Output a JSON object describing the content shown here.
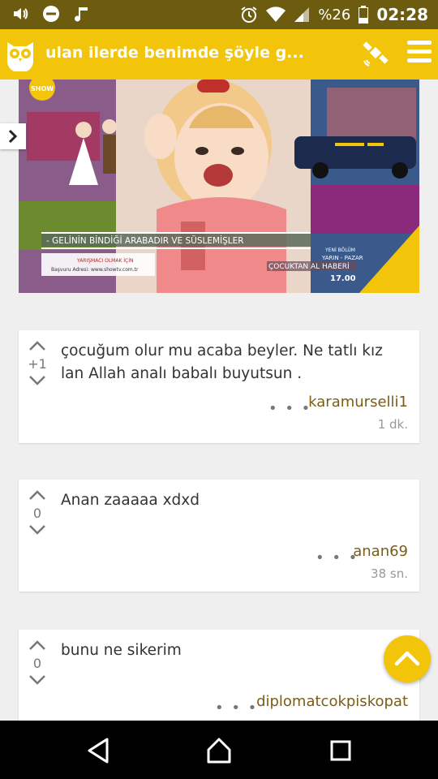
{
  "status_bar": {
    "battery": "%26",
    "time": "02:28"
  },
  "app_bar": {
    "title": "ulan ilerde benimde şöyle g..."
  },
  "media": {
    "badge_show": "SHOW",
    "banner": "- GELİNİN BİNDİĞİ ARABADIR VE SÜSLEMİŞLER",
    "promo_line1": "YARIŞMACI OLMAK İÇİN",
    "promo_line2": "Başvuru Adresi: www.showtv.com.tr",
    "next_label": "YENİ BÖLÜM",
    "day": "YARIN - PAZAR",
    "program": "ÇOCUKTAN AL HABERİ",
    "hour": "17.00"
  },
  "comments": [
    {
      "score": "+1",
      "text": "çocuğum olur mu acaba beyler. Ne tatlı kız lan Allah analı babalı buyutsun .",
      "author": "karamurselli1",
      "time": "1 dk."
    },
    {
      "score": "0",
      "text": "Anan zaaaaa xdxd",
      "author": "anan69",
      "time": "38 sn."
    },
    {
      "score": "0",
      "text": "bunu ne sikerim",
      "author": "diplomatcokpiskopat",
      "time": ""
    }
  ],
  "colors": {
    "accent": "#f2c40a",
    "status_bar": "#6d5c10",
    "author": "#7a5e16"
  },
  "icons": [
    "volume-icon",
    "dnd-icon",
    "music-icon",
    "alarm-icon",
    "wifi-icon",
    "signal-icon",
    "battery-icon",
    "owl-logo-icon",
    "satellite-icon",
    "menu-icon",
    "chevron-right-icon",
    "upvote-icon",
    "downvote-icon",
    "more-icon",
    "scroll-top-icon",
    "back-icon",
    "home-icon",
    "recents-icon"
  ]
}
